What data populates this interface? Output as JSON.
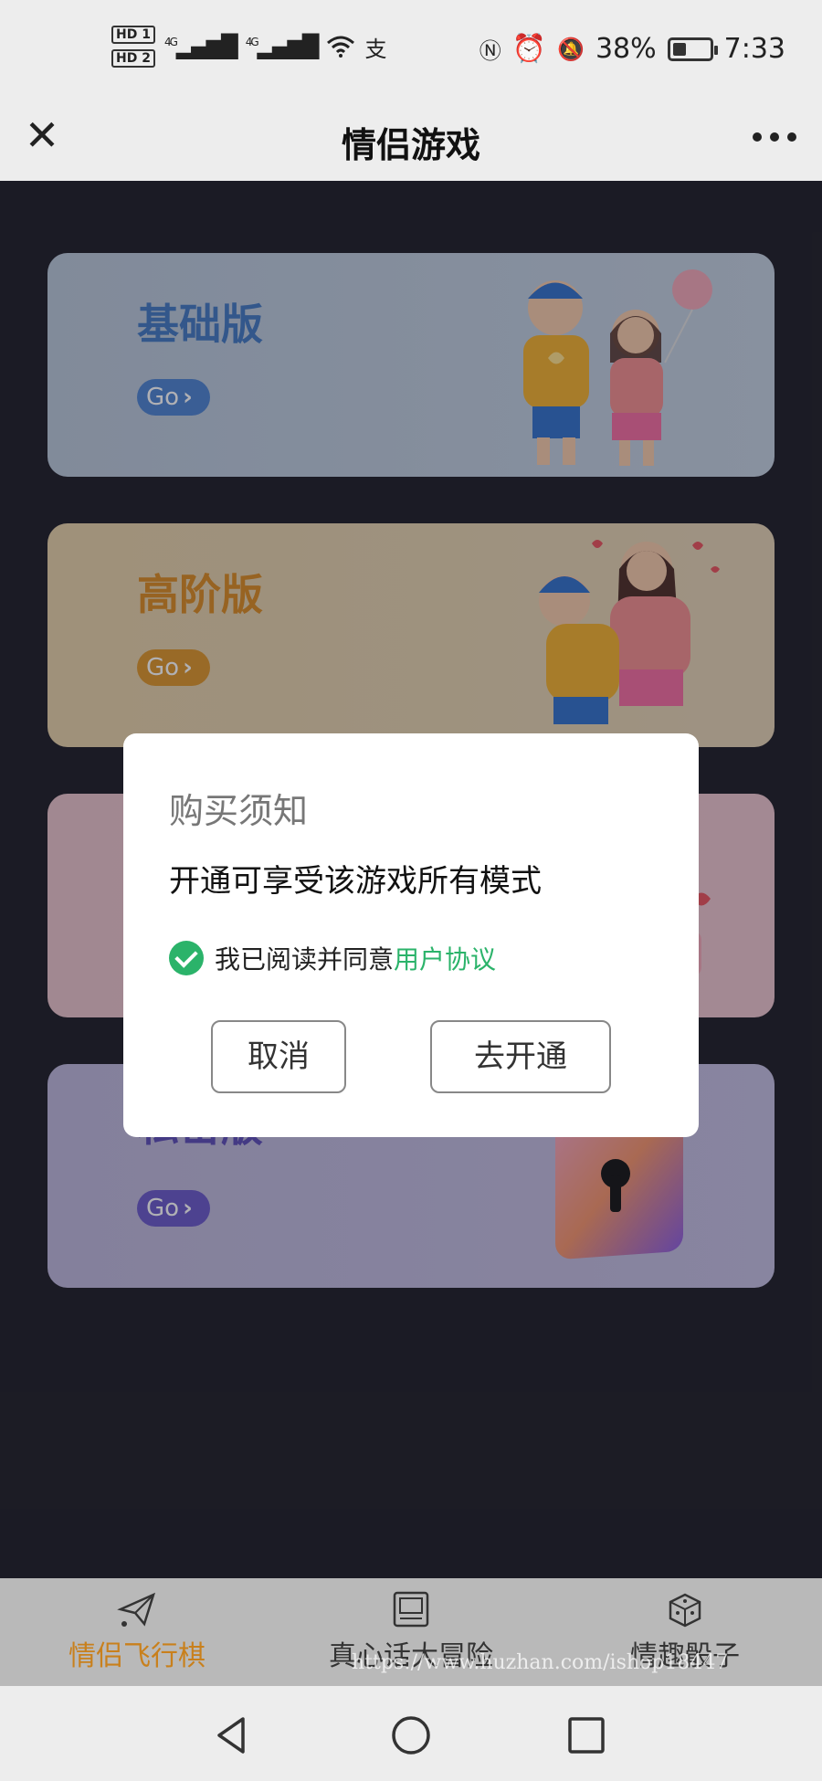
{
  "status_bar": {
    "hd1": "HD 1",
    "hd2": "HD 2",
    "signal1": "4G",
    "signal2": "4G",
    "battery_percent": "38%",
    "battery_level": 0.38,
    "time": "7:33"
  },
  "header": {
    "title": "情侣游戏",
    "close_icon": "close-icon",
    "more_icon": "more-dots-icon"
  },
  "cards": [
    {
      "name": "基础版",
      "go_label": "Go",
      "accent": "#4b82cf"
    },
    {
      "name": "高阶版",
      "go_label": "Go",
      "accent": "#dc9427"
    },
    {
      "name": "",
      "go_label": "",
      "accent": "#e9a0b0"
    },
    {
      "name": "私密版",
      "go_label": "Go",
      "accent": "#6756c8"
    }
  ],
  "dialog": {
    "title": "购买须知",
    "message": "开通可享受该游戏所有模式",
    "agree_text": "我已阅读并同意",
    "agree_link": "用户协议",
    "agree_checked": true,
    "cancel_label": "取消",
    "confirm_label": "去开通",
    "check_color": "#2bb36a"
  },
  "tabs": [
    {
      "label": "情侣飞行棋",
      "icon": "paper-plane-icon",
      "active": true
    },
    {
      "label": "真心话大冒险",
      "icon": "card-icon",
      "active": false
    },
    {
      "label": "情趣骰子",
      "icon": "dice-icon",
      "active": false
    }
  ],
  "watermark": "https://www.huzhan.com/ishop18447",
  "nav": {
    "back_icon": "nav-back-icon",
    "home_icon": "nav-home-icon",
    "recent_icon": "nav-recent-icon"
  }
}
